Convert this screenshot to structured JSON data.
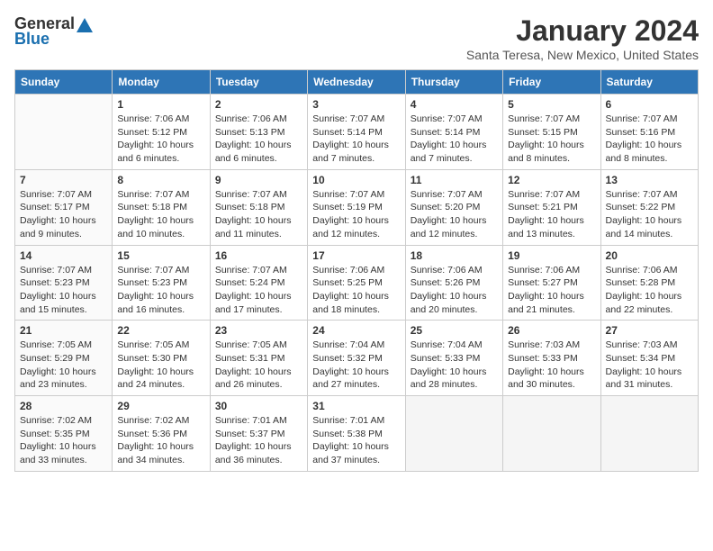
{
  "header": {
    "logo_general": "General",
    "logo_blue": "Blue",
    "title": "January 2024",
    "location": "Santa Teresa, New Mexico, United States"
  },
  "calendar": {
    "headers": [
      "Sunday",
      "Monday",
      "Tuesday",
      "Wednesday",
      "Thursday",
      "Friday",
      "Saturday"
    ],
    "weeks": [
      [
        {
          "day": "",
          "sunrise": "",
          "sunset": "",
          "daylight": ""
        },
        {
          "day": "1",
          "sunrise": "Sunrise: 7:06 AM",
          "sunset": "Sunset: 5:12 PM",
          "daylight": "Daylight: 10 hours and 6 minutes."
        },
        {
          "day": "2",
          "sunrise": "Sunrise: 7:06 AM",
          "sunset": "Sunset: 5:13 PM",
          "daylight": "Daylight: 10 hours and 6 minutes."
        },
        {
          "day": "3",
          "sunrise": "Sunrise: 7:07 AM",
          "sunset": "Sunset: 5:14 PM",
          "daylight": "Daylight: 10 hours and 7 minutes."
        },
        {
          "day": "4",
          "sunrise": "Sunrise: 7:07 AM",
          "sunset": "Sunset: 5:14 PM",
          "daylight": "Daylight: 10 hours and 7 minutes."
        },
        {
          "day": "5",
          "sunrise": "Sunrise: 7:07 AM",
          "sunset": "Sunset: 5:15 PM",
          "daylight": "Daylight: 10 hours and 8 minutes."
        },
        {
          "day": "6",
          "sunrise": "Sunrise: 7:07 AM",
          "sunset": "Sunset: 5:16 PM",
          "daylight": "Daylight: 10 hours and 8 minutes."
        }
      ],
      [
        {
          "day": "7",
          "sunrise": "Sunrise: 7:07 AM",
          "sunset": "Sunset: 5:17 PM",
          "daylight": "Daylight: 10 hours and 9 minutes."
        },
        {
          "day": "8",
          "sunrise": "Sunrise: 7:07 AM",
          "sunset": "Sunset: 5:18 PM",
          "daylight": "Daylight: 10 hours and 10 minutes."
        },
        {
          "day": "9",
          "sunrise": "Sunrise: 7:07 AM",
          "sunset": "Sunset: 5:18 PM",
          "daylight": "Daylight: 10 hours and 11 minutes."
        },
        {
          "day": "10",
          "sunrise": "Sunrise: 7:07 AM",
          "sunset": "Sunset: 5:19 PM",
          "daylight": "Daylight: 10 hours and 12 minutes."
        },
        {
          "day": "11",
          "sunrise": "Sunrise: 7:07 AM",
          "sunset": "Sunset: 5:20 PM",
          "daylight": "Daylight: 10 hours and 12 minutes."
        },
        {
          "day": "12",
          "sunrise": "Sunrise: 7:07 AM",
          "sunset": "Sunset: 5:21 PM",
          "daylight": "Daylight: 10 hours and 13 minutes."
        },
        {
          "day": "13",
          "sunrise": "Sunrise: 7:07 AM",
          "sunset": "Sunset: 5:22 PM",
          "daylight": "Daylight: 10 hours and 14 minutes."
        }
      ],
      [
        {
          "day": "14",
          "sunrise": "Sunrise: 7:07 AM",
          "sunset": "Sunset: 5:23 PM",
          "daylight": "Daylight: 10 hours and 15 minutes."
        },
        {
          "day": "15",
          "sunrise": "Sunrise: 7:07 AM",
          "sunset": "Sunset: 5:23 PM",
          "daylight": "Daylight: 10 hours and 16 minutes."
        },
        {
          "day": "16",
          "sunrise": "Sunrise: 7:07 AM",
          "sunset": "Sunset: 5:24 PM",
          "daylight": "Daylight: 10 hours and 17 minutes."
        },
        {
          "day": "17",
          "sunrise": "Sunrise: 7:06 AM",
          "sunset": "Sunset: 5:25 PM",
          "daylight": "Daylight: 10 hours and 18 minutes."
        },
        {
          "day": "18",
          "sunrise": "Sunrise: 7:06 AM",
          "sunset": "Sunset: 5:26 PM",
          "daylight": "Daylight: 10 hours and 20 minutes."
        },
        {
          "day": "19",
          "sunrise": "Sunrise: 7:06 AM",
          "sunset": "Sunset: 5:27 PM",
          "daylight": "Daylight: 10 hours and 21 minutes."
        },
        {
          "day": "20",
          "sunrise": "Sunrise: 7:06 AM",
          "sunset": "Sunset: 5:28 PM",
          "daylight": "Daylight: 10 hours and 22 minutes."
        }
      ],
      [
        {
          "day": "21",
          "sunrise": "Sunrise: 7:05 AM",
          "sunset": "Sunset: 5:29 PM",
          "daylight": "Daylight: 10 hours and 23 minutes."
        },
        {
          "day": "22",
          "sunrise": "Sunrise: 7:05 AM",
          "sunset": "Sunset: 5:30 PM",
          "daylight": "Daylight: 10 hours and 24 minutes."
        },
        {
          "day": "23",
          "sunrise": "Sunrise: 7:05 AM",
          "sunset": "Sunset: 5:31 PM",
          "daylight": "Daylight: 10 hours and 26 minutes."
        },
        {
          "day": "24",
          "sunrise": "Sunrise: 7:04 AM",
          "sunset": "Sunset: 5:32 PM",
          "daylight": "Daylight: 10 hours and 27 minutes."
        },
        {
          "day": "25",
          "sunrise": "Sunrise: 7:04 AM",
          "sunset": "Sunset: 5:33 PM",
          "daylight": "Daylight: 10 hours and 28 minutes."
        },
        {
          "day": "26",
          "sunrise": "Sunrise: 7:03 AM",
          "sunset": "Sunset: 5:33 PM",
          "daylight": "Daylight: 10 hours and 30 minutes."
        },
        {
          "day": "27",
          "sunrise": "Sunrise: 7:03 AM",
          "sunset": "Sunset: 5:34 PM",
          "daylight": "Daylight: 10 hours and 31 minutes."
        }
      ],
      [
        {
          "day": "28",
          "sunrise": "Sunrise: 7:02 AM",
          "sunset": "Sunset: 5:35 PM",
          "daylight": "Daylight: 10 hours and 33 minutes."
        },
        {
          "day": "29",
          "sunrise": "Sunrise: 7:02 AM",
          "sunset": "Sunset: 5:36 PM",
          "daylight": "Daylight: 10 hours and 34 minutes."
        },
        {
          "day": "30",
          "sunrise": "Sunrise: 7:01 AM",
          "sunset": "Sunset: 5:37 PM",
          "daylight": "Daylight: 10 hours and 36 minutes."
        },
        {
          "day": "31",
          "sunrise": "Sunrise: 7:01 AM",
          "sunset": "Sunset: 5:38 PM",
          "daylight": "Daylight: 10 hours and 37 minutes."
        },
        {
          "day": "",
          "sunrise": "",
          "sunset": "",
          "daylight": ""
        },
        {
          "day": "",
          "sunrise": "",
          "sunset": "",
          "daylight": ""
        },
        {
          "day": "",
          "sunrise": "",
          "sunset": "",
          "daylight": ""
        }
      ]
    ]
  }
}
